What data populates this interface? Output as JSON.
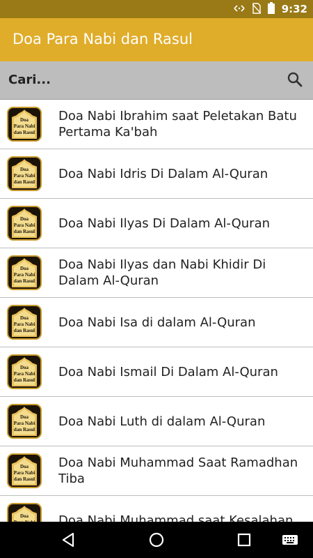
{
  "status_bar": {
    "time": "9:32",
    "icons": [
      "wifi-data-icon",
      "no-sim-icon",
      "battery-icon"
    ]
  },
  "app_bar": {
    "title": "Doa Para Nabi dan Rasul"
  },
  "search": {
    "placeholder": "Cari...",
    "icon": "search-icon"
  },
  "thumbnail_text": {
    "line1": "Doa",
    "line2": "Para Nabi",
    "line3": "dan Rasul"
  },
  "list": {
    "items": [
      {
        "label": "Doa Nabi Ibrahim saat Peletakan Batu Pertama Ka'bah"
      },
      {
        "label": "Doa Nabi Idris Di Dalam Al-Quran"
      },
      {
        "label": "Doa Nabi Ilyas Di Dalam Al-Quran"
      },
      {
        "label": "Doa Nabi Ilyas dan Nabi Khidir Di Dalam Al-Quran"
      },
      {
        "label": "Doa Nabi Isa di dalam Al-Quran"
      },
      {
        "label": "Doa Nabi Ismail Di Dalam Al-Quran"
      },
      {
        "label": "Doa Nabi Luth di dalam Al-Quran"
      },
      {
        "label": "Doa Nabi Muhammad Saat Ramadhan Tiba"
      },
      {
        "label": "Doa Nabi Muhammad saat Kesalahan"
      }
    ]
  },
  "nav_bar": {
    "icons": [
      "back-icon",
      "home-icon",
      "recents-icon",
      "keyboard-icon"
    ]
  },
  "colors": {
    "status_bar": "#9a7a16",
    "app_bar": "#e0ad2a",
    "search_bar": "#bdbdbd",
    "thumb_border": "#c89a2c"
  }
}
